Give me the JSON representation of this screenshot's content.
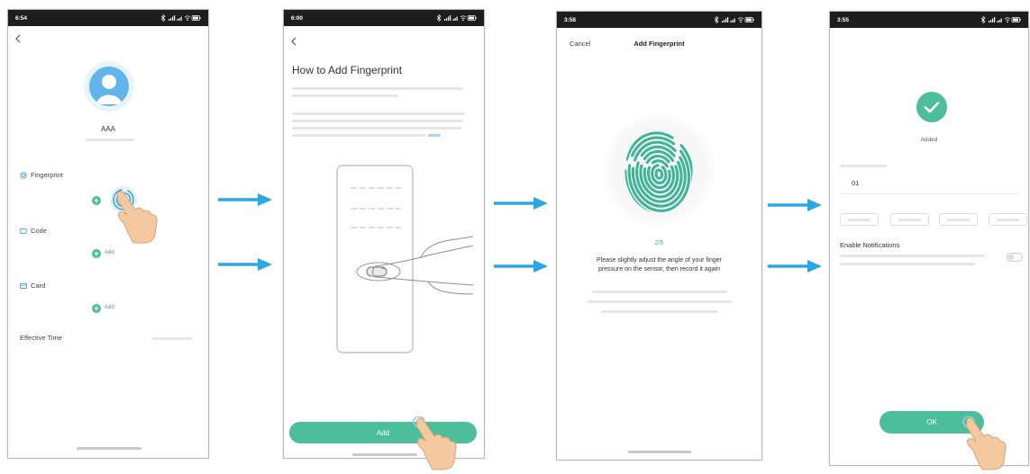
{
  "colors": {
    "accent_green": "#4DBE9A",
    "arrow_blue": "#2BA8E1",
    "avatar_blue": "#62B5EA",
    "fingerprint_teal": "#3BB594",
    "status_bar": "#1d1d1d"
  },
  "icons": {
    "back": "chevron-left-icon",
    "avatar": "user-icon",
    "fingerprint": "fingerprint-icon",
    "check": "check-icon",
    "hand": "hand-pointer-icon",
    "arrow": "arrow-right-icon"
  },
  "screen_user_detail": {
    "status_time": "6:54",
    "user_name": "AAA",
    "fingerprint_label": "Fingerprint",
    "code_label": "Code",
    "code_add_label": "Add",
    "card_label": "Card",
    "card_add_label": "Add",
    "effective_time_label": "Effective Time"
  },
  "screen_how_to": {
    "status_time": "6:00",
    "title": "How to Add Fingerprint",
    "add_button_label": "Add"
  },
  "screen_enroll": {
    "status_time": "3:58",
    "cancel_label": "Cancel",
    "title": "Add Fingerprint",
    "progress": "2/5",
    "instruction_lines": [
      "Please slightly adjust the angle of your finger",
      "pressure on the sensor, then record it again"
    ]
  },
  "screen_added": {
    "status_time": "3:55",
    "result_label": "Added",
    "name_value": "01",
    "notifications_label": "Enable Notifications",
    "ok_button_label": "OK"
  }
}
